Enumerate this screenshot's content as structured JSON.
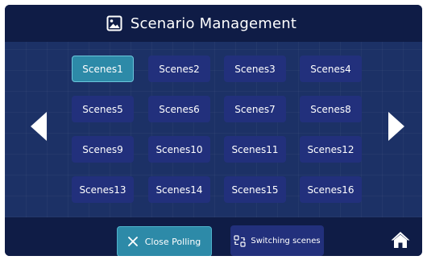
{
  "header": {
    "title": "Scenario Management",
    "icon": "image-icon"
  },
  "scenes": [
    {
      "label": "Scenes1",
      "active": true
    },
    {
      "label": "Scenes2",
      "active": false
    },
    {
      "label": "Scenes3",
      "active": false
    },
    {
      "label": "Scenes4",
      "active": false
    },
    {
      "label": "Scenes5",
      "active": false
    },
    {
      "label": "Scenes6",
      "active": false
    },
    {
      "label": "Scenes7",
      "active": false
    },
    {
      "label": "Scenes8",
      "active": false
    },
    {
      "label": "Scenes9",
      "active": false
    },
    {
      "label": "Scenes10",
      "active": false
    },
    {
      "label": "Scenes11",
      "active": false
    },
    {
      "label": "Scenes12",
      "active": false
    },
    {
      "label": "Scenes13",
      "active": false
    },
    {
      "label": "Scenes14",
      "active": false
    },
    {
      "label": "Scenes15",
      "active": false
    },
    {
      "label": "Scenes16",
      "active": false
    }
  ],
  "nav": {
    "prev_icon": "triangle-left-icon",
    "next_icon": "triangle-right-icon"
  },
  "footer": {
    "close_polling_label": "Close Polling",
    "close_icon": "close-icon",
    "switching_scenes_label": "Switching scenes",
    "switch_icon": "switch-scenes-icon",
    "home_icon": "home-icon"
  },
  "colors": {
    "header_bg": "#0f1c46",
    "body_bg": "#1c3166",
    "button_bg": "#22307c",
    "accent_teal": "#2d8aa8",
    "text": "#ffffff"
  }
}
